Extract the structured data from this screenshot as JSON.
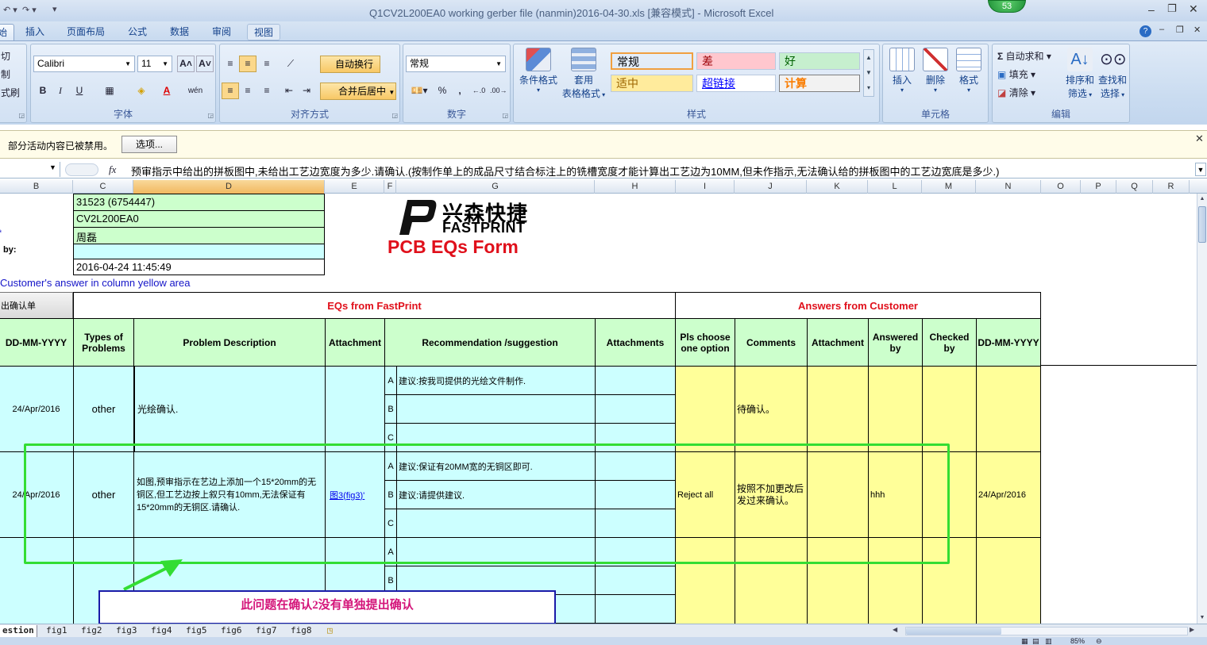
{
  "window": {
    "title": "Q1CV2L200EA0 working gerber file (nanmin)2016-04-30.xls  [兼容模式] - Microsoft Excel",
    "badge": "53"
  },
  "ribbon_tabs": [
    {
      "label": "始"
    },
    {
      "label": "插入"
    },
    {
      "label": "页面布局"
    },
    {
      "label": "公式"
    },
    {
      "label": "数据"
    },
    {
      "label": "审阅"
    },
    {
      "label": "视图"
    }
  ],
  "clipboard": {
    "cut": "切",
    "copy": "制",
    "format_painter": "式刷"
  },
  "font": {
    "name": "Calibri",
    "size": "11",
    "group_label": "字体",
    "bold": "B",
    "italic": "I",
    "underline": "U"
  },
  "alignment": {
    "wrap_text": "自动换行",
    "merge_center": "合并后居中",
    "group_label": "对齐方式"
  },
  "number": {
    "format": "常规",
    "group_label": "数字",
    "percent": "%",
    "comma": ","
  },
  "styles": {
    "conditional": "条件格式",
    "table_format_1": "套用",
    "table_format_2": "表格格式",
    "group_label": "样式",
    "cells": [
      {
        "label": "常规",
        "color": "#ffffff"
      },
      {
        "label": "差",
        "color": "#ffc7ce",
        "text": "#9c0006"
      },
      {
        "label": "好",
        "color": "#c6efce",
        "text": "#006100"
      },
      {
        "label": "适中",
        "color": "#ffeb9c",
        "text": "#9c6500"
      },
      {
        "label": "超链接",
        "color": "#ffffff",
        "text": "#0000ff"
      },
      {
        "label": "计算",
        "color": "#f2f2f2",
        "text": "#fa7d00"
      }
    ]
  },
  "cells_group": {
    "insert": "插入",
    "delete": "删除",
    "format": "格式",
    "group_label": "单元格"
  },
  "editing": {
    "autosum": "自动求和",
    "fill": "填充",
    "clear": "清除",
    "sort_1": "排序和",
    "sort_2": "筛选",
    "find_1": "查找和",
    "find_2": "选择",
    "group_label": "编辑"
  },
  "message_bar": {
    "text": "部分活动内容已被禁用。",
    "options_button": "选项..."
  },
  "formula_bar": {
    "fx": "fx",
    "content": "预审指示中给出的拼板图中,未给出工艺边宽度为多少.请确认.(按制作单上的成品尺寸结合标注上的铣槽宽度才能计算出工艺边为10MM,但未作指示,无法确认给的拼板图中的工艺边宽底是多少.)"
  },
  "columns": [
    "B",
    "C",
    "D",
    "E",
    "F",
    "G",
    "H",
    "I",
    "J",
    "K",
    "L",
    "M",
    "N",
    "O",
    "P",
    "Q",
    "R"
  ],
  "sheet": {
    "info": [
      "31523 (6754447)",
      "CV2L200EA0",
      "周磊",
      "",
      "2016-04-24 11:45:49"
    ],
    "by_label": "by:",
    "star": "*",
    "logo_cn": "兴森快捷",
    "logo_en": "FASTPRINT",
    "form_title": "PCB EQs Form",
    "instruction": "Customer's  answer in column yellow area",
    "confirm_label": "出确认单",
    "eqs_header": "EQs from FastPrint",
    "answers_header": "Answers from Customer",
    "headers": [
      "DD-MM-YYYY",
      "Types of Problems",
      "Problem Description",
      "Attachment",
      "Recommendation /suggestion",
      "Attachments",
      "Pls choose one option",
      "Comments",
      "Attachment",
      "Answered by",
      "Checked by",
      "DD-MM-YYYY"
    ],
    "rows": [
      {
        "date": "24/Apr/2016",
        "type": "other",
        "description": "光绘确认.",
        "attachment": "",
        "options": [
          {
            "letter": "A",
            "text": "建议:按我司提供的光绘文件制作."
          },
          {
            "letter": "B",
            "text": ""
          },
          {
            "letter": "C",
            "text": ""
          }
        ],
        "choice": "",
        "comment": "待确认。",
        "answered_by": "",
        "answer_date": ""
      },
      {
        "date": "24/Apr/2016",
        "type": "other",
        "description": "如图,预审指示在艺边上添加一个15*20mm的无铜区,但工艺边按上叙只有10mm,无法保证有15*20mm的无铜区.请确认.",
        "attachment": "图3(fig3)'",
        "options": [
          {
            "letter": "A",
            "text": "建议:保证有20MM宽的无铜区即可."
          },
          {
            "letter": "B",
            "text": "建议:请提供建议."
          },
          {
            "letter": "C",
            "text": ""
          }
        ],
        "choice": "Reject all",
        "comment": "按照不加更改后发过来确认。",
        "answered_by": "hhh",
        "answer_date": "24/Apr/2016"
      },
      {
        "date": "",
        "type": "",
        "description": "",
        "attachment": "",
        "options": [
          {
            "letter": "A",
            "text": ""
          },
          {
            "letter": "B",
            "text": ""
          }
        ],
        "choice": "",
        "comment": "",
        "answered_by": "",
        "answer_date": ""
      }
    ],
    "annotation": "此问题在确认2没有单独提出确认"
  },
  "sheet_tabs": [
    "estion",
    "fig1",
    "fig2",
    "fig3",
    "fig4",
    "fig5",
    "fig6",
    "fig7",
    "fig8"
  ],
  "status": {
    "zoom": "85%"
  },
  "colors": {
    "accent": "#15428b",
    "highlight_box": "#33dd33",
    "annotation_box": "#1a1aa8",
    "title_red": "#e0101b"
  }
}
